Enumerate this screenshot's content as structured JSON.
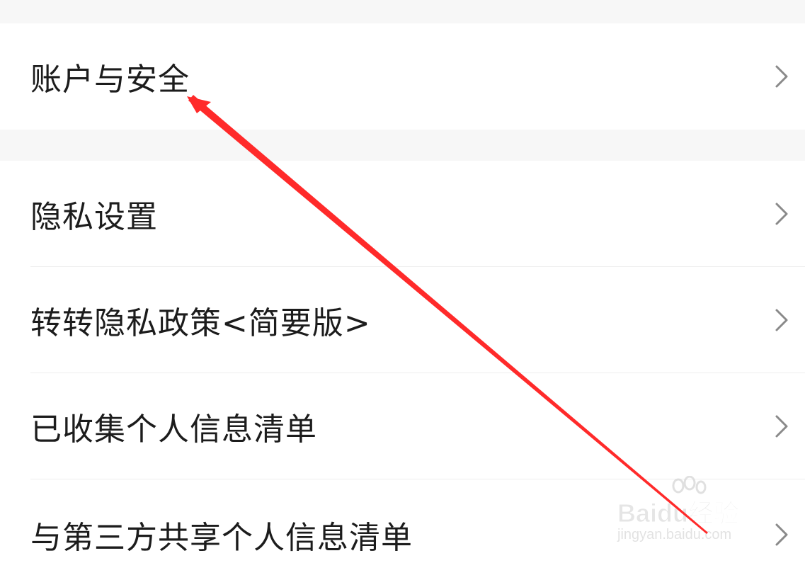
{
  "settings": {
    "account_security": "账户与安全",
    "privacy_items": [
      "隐私设置",
      "转转隐私政策<简要版>",
      "已收集个人信息清单",
      "与第三方共享个人信息清单"
    ]
  },
  "watermark": {
    "brand": "Baidu经验",
    "url": "jingyan.baidu.com"
  },
  "colors": {
    "background": "#f7f7f7",
    "row": "#ffffff",
    "text": "#1c1c1c",
    "chevron": "#8a8a8a",
    "annotation_arrow": "#ff2a2a"
  }
}
